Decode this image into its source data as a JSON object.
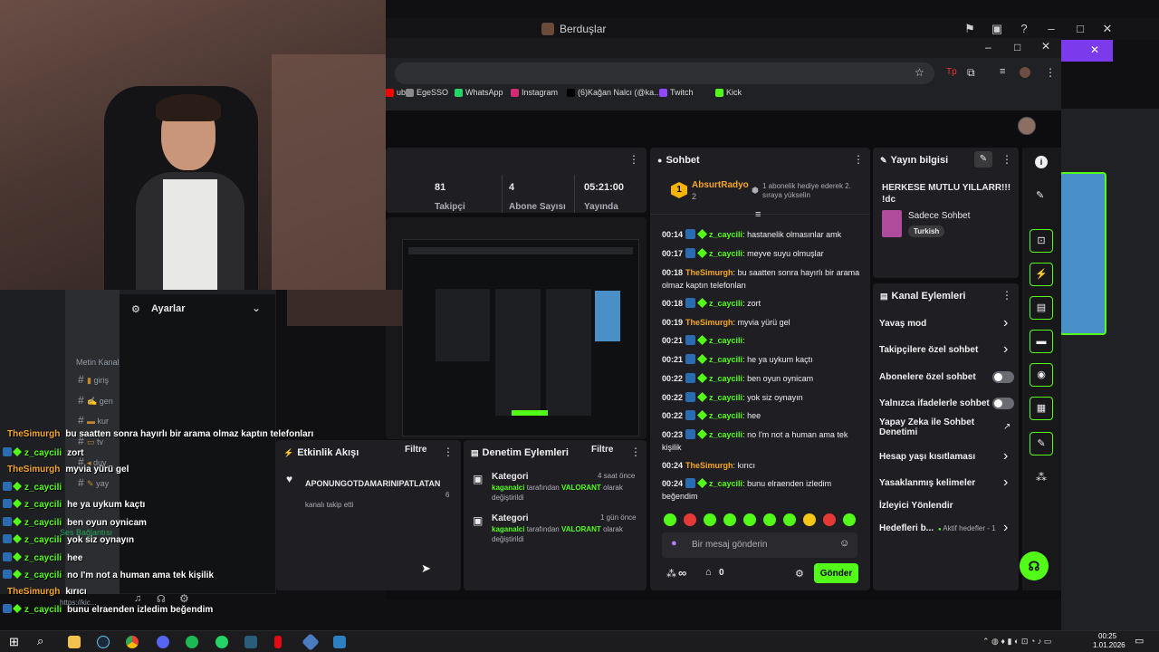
{
  "window": {
    "title": "Berduşlar"
  },
  "bookmarks": [
    {
      "label": "ube",
      "color": "#ff0000"
    },
    {
      "label": "EgeSSO",
      "color": "#8a8a8a"
    },
    {
      "label": "WhatsApp",
      "color": "#25d366"
    },
    {
      "label": "Instagram",
      "color": "#d62976"
    },
    {
      "label": "(6)Kağan Nalcı (@ka...",
      "color": "#000000"
    },
    {
      "label": "Twitch",
      "color": "#9146ff"
    },
    {
      "label": "Kick",
      "color": "#53fc18"
    }
  ],
  "stats": {
    "followers_value": "81",
    "followers_label": "Takipçi",
    "subs_value": "4",
    "subs_label": "Abone Sayısı",
    "uptime_value": "05:21:00",
    "uptime_label": "Yayında"
  },
  "chat": {
    "title": "Sohbet",
    "pinned_user": "AbsurtRadyo",
    "pinned_count": "2",
    "pinned_rank": "1",
    "gift_notice": "1 abonelik hediye ederek 2. sıraya yükselin",
    "messages": [
      {
        "time": "00:14",
        "user": "z_caycili",
        "color": "green",
        "badges": true,
        "text": "hastanelik olmasınlar amk"
      },
      {
        "time": "00:17",
        "user": "z_caycili",
        "color": "green",
        "badges": true,
        "text": "meyve suyu olmuşlar"
      },
      {
        "time": "00:18",
        "user": "TheSimurgh",
        "color": "orange",
        "badges": false,
        "text": "bu saatten sonra hayırlı bir arama olmaz kaptın telefonları"
      },
      {
        "time": "00:18",
        "user": "z_caycili",
        "color": "green",
        "badges": true,
        "text": "zort"
      },
      {
        "time": "00:19",
        "user": "TheSimurgh",
        "color": "orange",
        "badges": false,
        "text": "myvia yürü gel"
      },
      {
        "time": "00:21",
        "user": "z_caycili",
        "color": "green",
        "badges": true,
        "text": ""
      },
      {
        "time": "00:21",
        "user": "z_caycili",
        "color": "green",
        "badges": true,
        "text": "he ya uykum kaçtı"
      },
      {
        "time": "00:22",
        "user": "z_caycili",
        "color": "green",
        "badges": true,
        "text": "ben oyun oynicam"
      },
      {
        "time": "00:22",
        "user": "z_caycili",
        "color": "green",
        "badges": true,
        "text": "yok siz oynayın"
      },
      {
        "time": "00:22",
        "user": "z_caycili",
        "color": "green",
        "badges": true,
        "text": "hee"
      },
      {
        "time": "00:23",
        "user": "z_caycili",
        "color": "green",
        "badges": true,
        "text": "no I'm not a human ama tek kişilik"
      },
      {
        "time": "00:24",
        "user": "TheSimurgh",
        "color": "orange",
        "badges": false,
        "text": "kırıcı"
      },
      {
        "time": "00:24",
        "user": "z_caycili",
        "color": "green",
        "badges": true,
        "text": "bunu elraenden izledim beğendim"
      }
    ],
    "input_placeholder": "Bir mesaj gönderin",
    "infinity": "∞",
    "zero": "0",
    "send_label": "Gönder"
  },
  "stream_info": {
    "title": "Yayın bilgisi",
    "stream_title": "HERKESE MUTLU YILLARR!!! !dc",
    "category": "Sadece Sohbet",
    "tag": "Turkish"
  },
  "channel_actions": {
    "title": "Kanal Eylemleri",
    "items": [
      {
        "label": "Yavaş mod",
        "kind": "chevron"
      },
      {
        "label": "Takipçilere özel sohbet",
        "kind": "chevron"
      },
      {
        "label": "Abonelere özel sohbet",
        "kind": "switch"
      },
      {
        "label": "Yalnızca ifadelerle sohbet",
        "kind": "switch"
      },
      {
        "label": "Yapay Zeka ile Sohbet Denetimi",
        "kind": "external"
      },
      {
        "label": "Hesap yaşı kısıtlaması",
        "kind": "chevron"
      },
      {
        "label": "Yasaklanmış kelimeler",
        "kind": "chevron"
      },
      {
        "label": "İzleyici Yönlendir",
        "kind": "none"
      },
      {
        "label": "Hedefleri b...",
        "kind": "chevron",
        "extra": "Aktif hedefler - 1"
      }
    ]
  },
  "activity": {
    "title": "Etkinlik Akışı",
    "filter": "Filtre",
    "username": "APONUNGOTDAMARINIPATLATAN",
    "action": "kanalı takip etti",
    "age": "6"
  },
  "moderation": {
    "title": "Denetim Eylemleri",
    "filter": "Filtre",
    "items": [
      {
        "title": "Kategori",
        "time": "4 saat önce",
        "user": "kaganalci",
        "mid": "tarafından",
        "game": "VALORANT",
        "tail": "olarak değiştirildi"
      },
      {
        "title": "Kategori",
        "time": "1 gün önce",
        "user": "kaganalci",
        "mid": "tarafından",
        "game": "VALORANT",
        "tail": "olarak değiştirildi"
      }
    ]
  },
  "settings_panel": {
    "title": "Ayarlar"
  },
  "discord": {
    "section": "Metin Kanal",
    "channels": [
      "giriş",
      "gen",
      "kur",
      "tv",
      "duy",
      "yay"
    ],
    "voice_status": "Ses Bağlantısı",
    "link": "https://kic..."
  },
  "overlay_chat": [
    {
      "user": "TheSimurgh",
      "color": "orange",
      "badges": false,
      "text": "bu saatten sonra hayırlı bir arama olmaz kaptın telefonları"
    },
    {
      "user": "z_caycili",
      "color": "green",
      "badges": true,
      "text": "zort"
    },
    {
      "user": "TheSimurgh",
      "color": "orange",
      "badges": false,
      "text": "myvia yürü gel"
    },
    {
      "user": "z_caycili",
      "color": "green",
      "badges": true,
      "text": ""
    },
    {
      "user": "z_caycili",
      "color": "green",
      "badges": true,
      "text": "he ya uykum kaçtı"
    },
    {
      "user": "z_caycili",
      "color": "green",
      "badges": true,
      "text": "ben oyun oynicam"
    },
    {
      "user": "z_caycili",
      "color": "green",
      "badges": true,
      "text": "yok siz oynayın"
    },
    {
      "user": "z_caycili",
      "color": "green",
      "badges": true,
      "text": "hee"
    },
    {
      "user": "z_caycili",
      "color": "green",
      "badges": true,
      "text": "no I'm not a human ama tek kişilik"
    },
    {
      "user": "TheSimurgh",
      "color": "orange",
      "badges": false,
      "text": "kırıcı"
    },
    {
      "user": "z_caycili",
      "color": "green",
      "badges": true,
      "text": "bunu elraenden izledim beğendim"
    }
  ],
  "taskbar": {
    "time": "00:25",
    "date": "1.01.2026"
  },
  "colors": {
    "accent": "#53fc18",
    "orange_user": "#f5a623",
    "purple": "#7c3aed"
  }
}
